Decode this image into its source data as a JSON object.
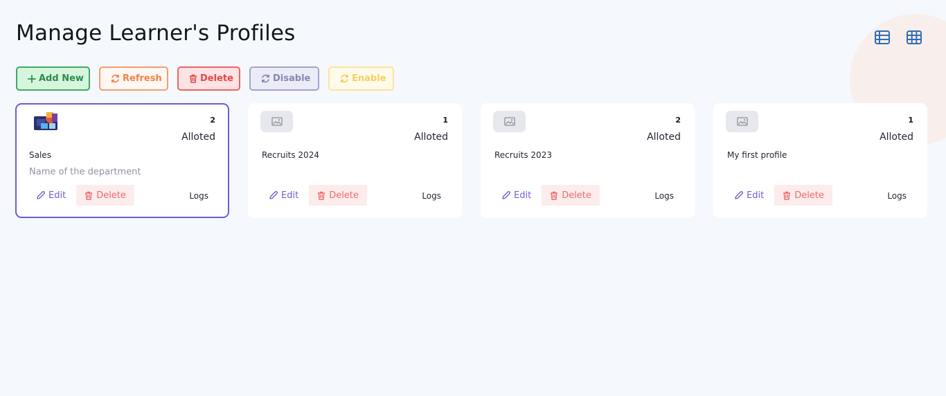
{
  "page": {
    "title": "Manage Learner's Profiles"
  },
  "view_toggles": [
    {
      "icon": "list-view-icon"
    },
    {
      "icon": "grid-view-icon"
    }
  ],
  "toolbar": {
    "add_label": "Add New",
    "refresh_label": "Refresh",
    "delete_label": "Delete",
    "disable_label": "Disable",
    "enable_label": "Enable"
  },
  "profiles": [
    {
      "count": "2",
      "alloted_label": "Alloted",
      "name": "Sales",
      "description": "Name of the department",
      "edit_label": "Edit",
      "delete_label": "Delete",
      "logs_label": "Logs",
      "thumbnail": "photo"
    },
    {
      "count": "1",
      "alloted_label": "Alloted",
      "name": "Recruits 2024",
      "description": "",
      "edit_label": "Edit",
      "delete_label": "Delete",
      "logs_label": "Logs",
      "thumbnail": "placeholder-image-icon"
    },
    {
      "count": "2",
      "alloted_label": "Alloted",
      "name": "Recruits 2023",
      "description": "",
      "edit_label": "Edit",
      "delete_label": "Delete",
      "logs_label": "Logs",
      "thumbnail": "placeholder-image-icon"
    },
    {
      "count": "1",
      "alloted_label": "Alloted",
      "name": "My first profile",
      "description": "",
      "edit_label": "Edit",
      "delete_label": "Delete",
      "logs_label": "Logs",
      "thumbnail": "placeholder-image-icon"
    }
  ],
  "colors": {
    "accent": "#6a5bd6",
    "view_icon": "#2f6db3",
    "background": "#f5f9fd"
  }
}
